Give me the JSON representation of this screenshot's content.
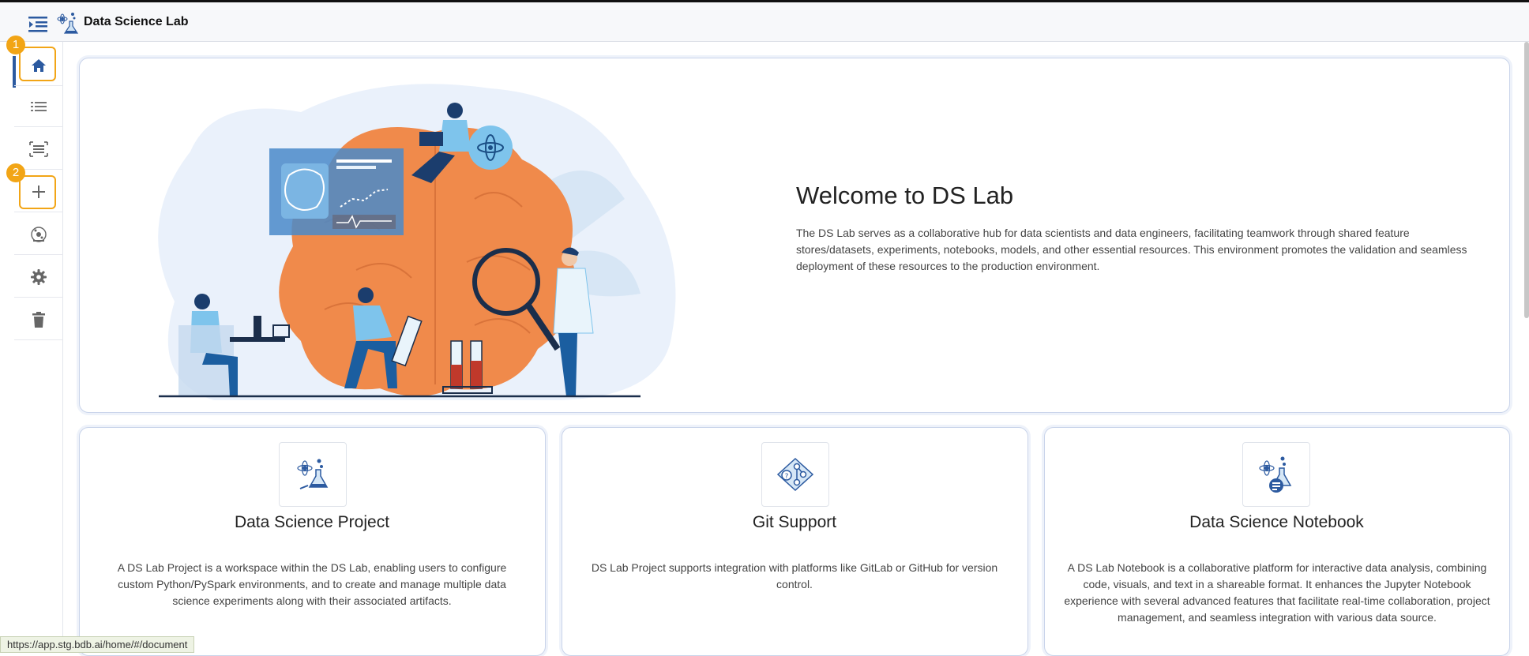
{
  "header": {
    "title": "Data Science Lab",
    "toggle_icon": "sidebar-toggle-icon",
    "logo_icon": "data-science-lab-logo"
  },
  "sidebar": {
    "items": [
      {
        "name": "home",
        "icon": "home-icon",
        "active": true
      },
      {
        "name": "list",
        "icon": "list-icon",
        "active": false
      },
      {
        "name": "model",
        "icon": "model-icon",
        "active": false
      },
      {
        "name": "create",
        "icon": "plus-icon",
        "active": false
      },
      {
        "name": "data-science",
        "icon": "ds-icon",
        "active": false
      },
      {
        "name": "settings",
        "icon": "gear-icon",
        "active": false
      },
      {
        "name": "trash",
        "icon": "trash-icon",
        "active": false
      }
    ],
    "callouts": [
      "1",
      "2"
    ]
  },
  "welcome": {
    "title": "Welcome to DS Lab",
    "description": "The DS Lab serves as a collaborative hub for data scientists and data engineers, facilitating teamwork through shared feature stores/datasets, experiments, notebooks, models, and other essential resources. This environment promotes the validation and seamless deployment of these resources to the production environment."
  },
  "features": [
    {
      "title": "Data Science Project",
      "icon": "data-science-project-icon",
      "description": "A DS Lab Project is a workspace within the DS Lab, enabling users to configure custom Python/PySpark environments, and to create and manage multiple data science experiments along with their associated artifacts."
    },
    {
      "title": "Git Support",
      "icon": "git-support-icon",
      "description": "DS Lab Project supports integration with platforms like GitLab or GitHub for version control."
    },
    {
      "title": "Data Science Notebook",
      "icon": "data-science-notebook-icon",
      "description": "A DS Lab Notebook is a collaborative platform for interactive data analysis, combining code, visuals, and text in a shareable format. It enhances the Jupyter Notebook experience with several advanced features that facilitate real-time collaboration, project management, and seamless integration with various data source."
    }
  ],
  "status_url": "https://app.stg.bdb.ai/home/#/document",
  "colors": {
    "accent": "#2c5aa0",
    "highlight": "#f2a516",
    "brain": "#f08a4b",
    "skin": "#63b9dd"
  }
}
